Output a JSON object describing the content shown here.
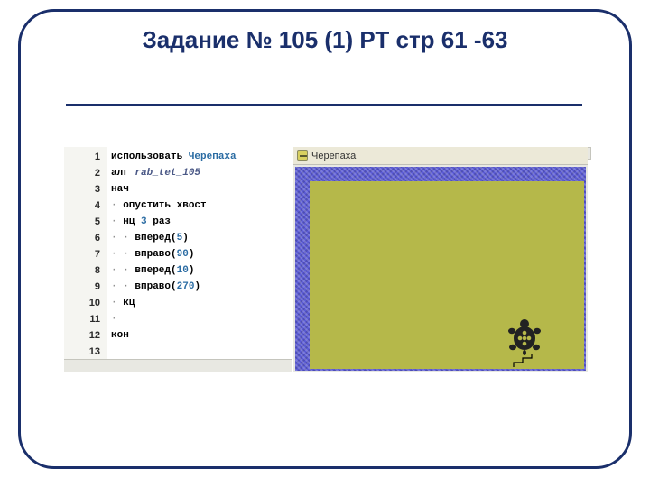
{
  "title": "Задание № 105 (1) РТ стр 61 -63",
  "turtle_window": {
    "title": "Черепаха"
  },
  "code_lines": [
    {
      "n": "1",
      "segments": [
        {
          "t": "использовать ",
          "c": "kw"
        },
        {
          "t": "Черепаха",
          "c": "ident"
        }
      ]
    },
    {
      "n": "2",
      "segments": [
        {
          "t": "алг ",
          "c": "kw"
        },
        {
          "t": "rab_tet_105",
          "c": "algname"
        }
      ]
    },
    {
      "n": "3",
      "segments": [
        {
          "t": "нач",
          "c": "kw"
        }
      ]
    },
    {
      "n": "4",
      "segments": [
        {
          "t": "· ",
          "c": "dot"
        },
        {
          "t": "опустить хвост",
          "c": "kw"
        }
      ]
    },
    {
      "n": "5",
      "segments": [
        {
          "t": "· ",
          "c": "dot"
        },
        {
          "t": "нц ",
          "c": "kw"
        },
        {
          "t": "3",
          "c": "num"
        },
        {
          "t": " раз",
          "c": "kw"
        }
      ]
    },
    {
      "n": "6",
      "segments": [
        {
          "t": "· · ",
          "c": "dot"
        },
        {
          "t": "вперед",
          "c": "kw"
        },
        {
          "t": "(",
          "c": "par"
        },
        {
          "t": "5",
          "c": "num"
        },
        {
          "t": ")",
          "c": "par"
        }
      ]
    },
    {
      "n": "7",
      "segments": [
        {
          "t": "· · ",
          "c": "dot"
        },
        {
          "t": "вправо",
          "c": "kw"
        },
        {
          "t": "(",
          "c": "par"
        },
        {
          "t": "90",
          "c": "num"
        },
        {
          "t": ")",
          "c": "par"
        }
      ]
    },
    {
      "n": "8",
      "segments": [
        {
          "t": "· · ",
          "c": "dot"
        },
        {
          "t": "вперед",
          "c": "kw"
        },
        {
          "t": "(",
          "c": "par"
        },
        {
          "t": "10",
          "c": "num"
        },
        {
          "t": ")",
          "c": "par"
        }
      ]
    },
    {
      "n": "9",
      "segments": [
        {
          "t": "· · ",
          "c": "dot"
        },
        {
          "t": "вправо",
          "c": "kw"
        },
        {
          "t": "(",
          "c": "par"
        },
        {
          "t": "270",
          "c": "num"
        },
        {
          "t": ")",
          "c": "par"
        }
      ]
    },
    {
      "n": "10",
      "segments": [
        {
          "t": "· ",
          "c": "dot"
        },
        {
          "t": "кц",
          "c": "kw"
        }
      ]
    },
    {
      "n": "11",
      "segments": [
        {
          "t": "·",
          "c": "dot"
        }
      ]
    },
    {
      "n": "12",
      "segments": [
        {
          "t": "кон",
          "c": "kw"
        }
      ]
    },
    {
      "n": "13",
      "segments": []
    }
  ]
}
